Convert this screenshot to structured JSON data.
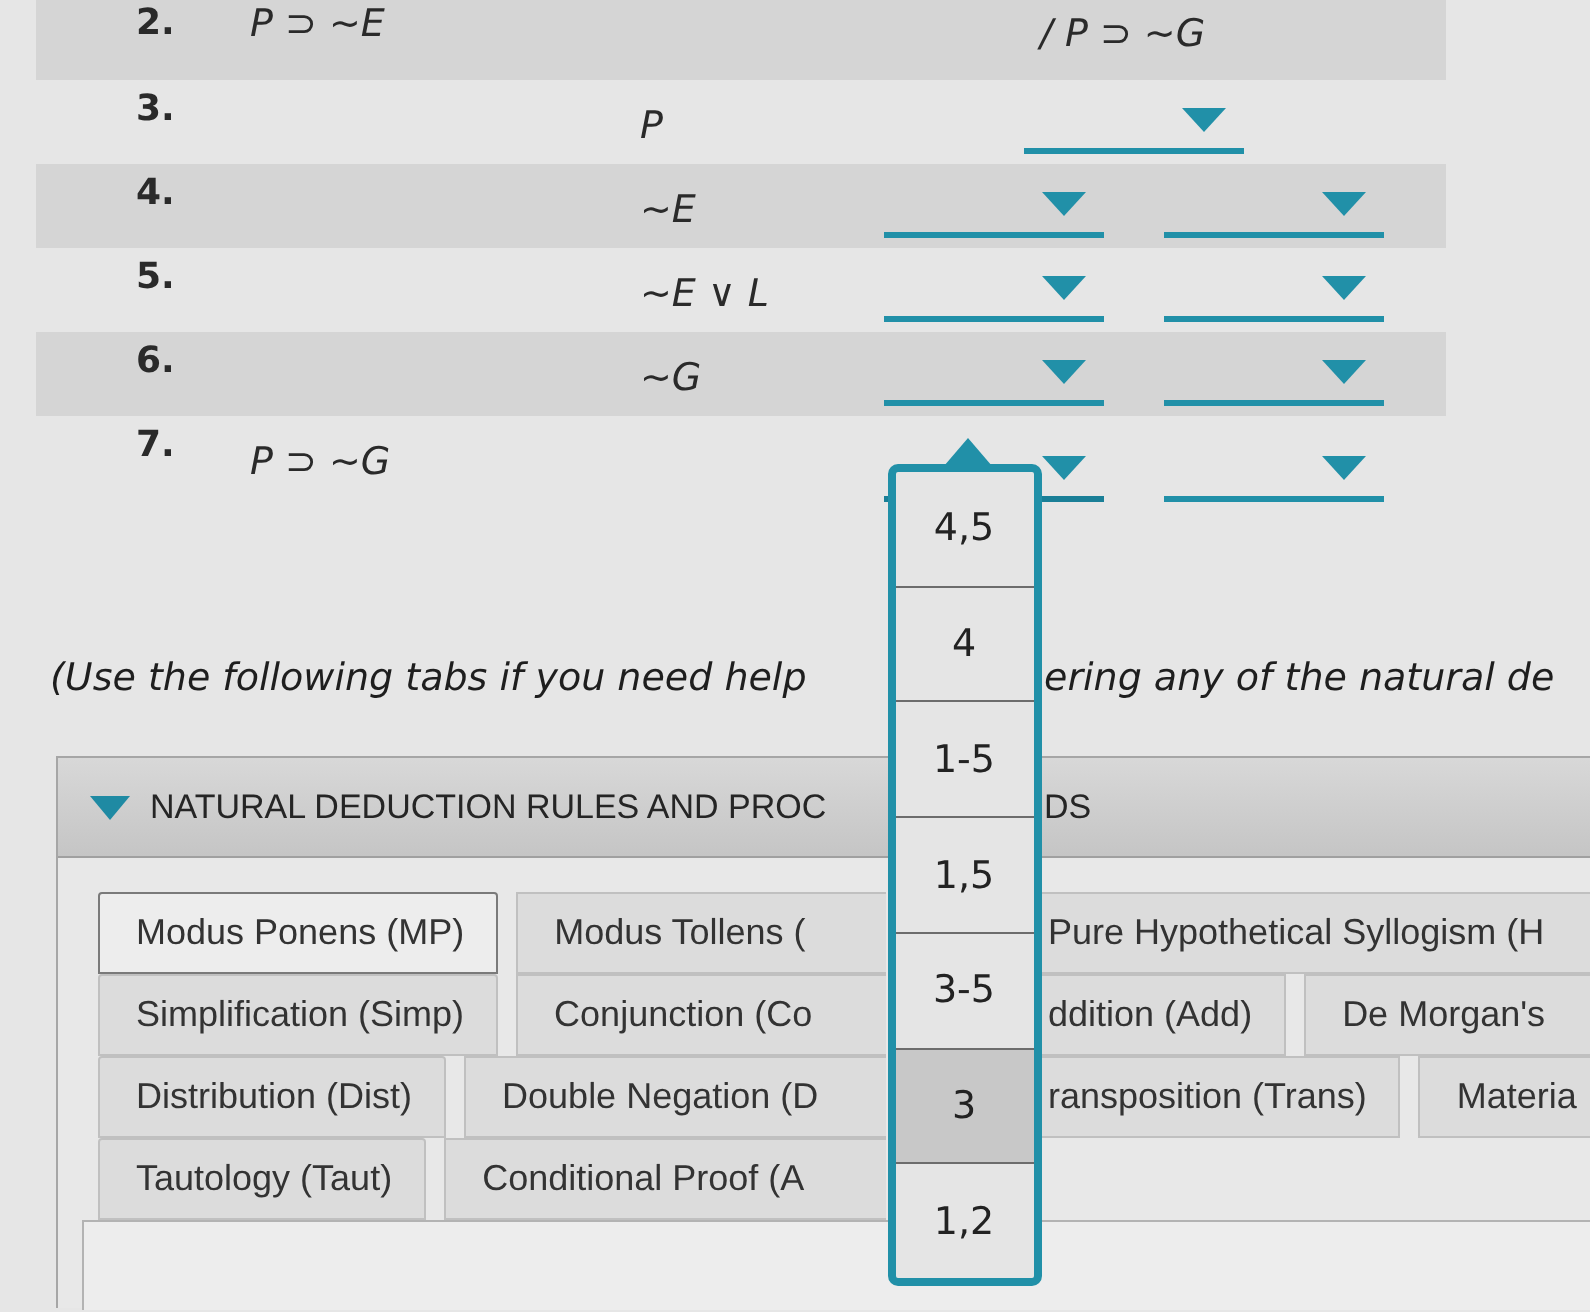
{
  "proof": {
    "lines": [
      {
        "kind": "premise",
        "number": "2.",
        "formula": "P ⊃ ~E",
        "conclusion": "/ P ⊃ ~G"
      },
      {
        "kind": "subproof",
        "children": [
          {
            "kind": "line",
            "number": "3.",
            "formula": "P",
            "dropdowns": [
              {
                "open": false
              }
            ]
          },
          {
            "kind": "line",
            "number": "4.",
            "formula": "~E",
            "dropdowns": [
              {
                "open": false
              },
              {
                "open": false
              }
            ]
          },
          {
            "kind": "line",
            "number": "5.",
            "formula": "~E ∨ L",
            "dropdowns": [
              {
                "open": false
              },
              {
                "open": false
              }
            ]
          },
          {
            "kind": "line",
            "number": "6.",
            "formula": "~G",
            "dropdowns": [
              {
                "open": false
              },
              {
                "open": false
              }
            ]
          }
        ]
      },
      {
        "kind": "line",
        "number": "7.",
        "formula": "P ⊃ ~G",
        "dropdowns": [
          {
            "open": true,
            "options": [
              {
                "label": "4,5",
                "selected": false
              },
              {
                "label": "4",
                "selected": false
              },
              {
                "label": "1-5",
                "selected": false
              },
              {
                "label": "1,5",
                "selected": false
              },
              {
                "label": "3-5",
                "selected": false
              },
              {
                "label": "3",
                "selected": true
              },
              {
                "label": "1,2",
                "selected": false
              }
            ]
          },
          {
            "open": false
          }
        ]
      }
    ]
  },
  "instruction": [
    "(Use the following tabs if you need help",
    "ering any of the natural de"
  ],
  "rules_panel": {
    "expanded": true,
    "title": [
      "NATURAL DEDUCTION RULES AND PROC",
      "DS"
    ],
    "tab_rows": [
      [
        {
          "label": "Modus Ponens (MP)",
          "selected": true
        },
        {
          "label": "Modus Tollens (",
          "selected": false
        },
        {
          "label": "Pure Hypothetical Syllogism (H",
          "selected": false
        }
      ],
      [
        {
          "label": "Simplification (Simp)",
          "selected": false
        },
        {
          "label": "Conjunction (Co",
          "selected": false
        },
        {
          "label": "ddition (Add)",
          "selected": false
        },
        {
          "label": "De Morgan's",
          "selected": false
        }
      ],
      [
        {
          "label": "Distribution (Dist)",
          "selected": false
        },
        {
          "label": "Double Negation (D",
          "selected": false
        },
        {
          "label": "ransposition (Trans)",
          "selected": false
        },
        {
          "label": "Materia",
          "selected": false
        }
      ],
      [
        {
          "label": "Tautology (Taut)",
          "selected": false
        },
        {
          "label": "Conditional Proof (A",
          "selected": false
        }
      ]
    ]
  }
}
